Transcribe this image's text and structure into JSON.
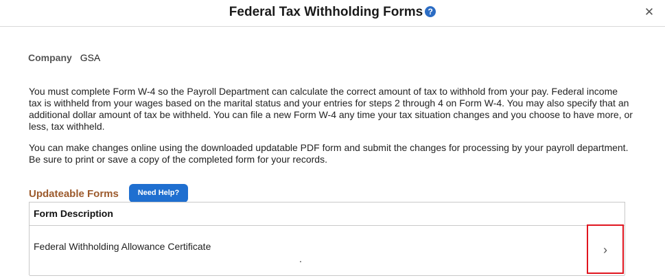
{
  "header": {
    "title": "Federal Tax Withholding Forms",
    "help_icon_glyph": "?",
    "close_icon_glyph": "✕"
  },
  "company": {
    "label": "Company",
    "value": "GSA"
  },
  "paragraphs": {
    "p1": "You must complete Form W-4 so the Payroll Department can calculate the correct amount of tax to withhold from your pay.  Federal income tax is withheld from your wages based on the marital status and your entries for steps 2 through 4 on Form W-4.  You may also specify that an additional dollar amount of tax be withheld.  You can file a new Form W-4 any time your tax situation changes and you choose to have more, or less, tax withheld.",
    "p2": "You can make changes online using the downloaded updatable PDF form and submit the changes for processing by your payroll department.  Be sure to print or save a copy of the completed form for your records."
  },
  "section": {
    "title": "Updateable Forms",
    "need_help_label": "Need Help?"
  },
  "grid": {
    "column_header": "Form Description",
    "rows": [
      {
        "description": "Federal Withholding Allowance Certificate",
        "trailing": "."
      }
    ],
    "chevron_glyph": "›"
  },
  "colors": {
    "section_title": "#9c5a2c",
    "button_blue": "#1f6fd0",
    "highlight_red": "#e0141e"
  }
}
